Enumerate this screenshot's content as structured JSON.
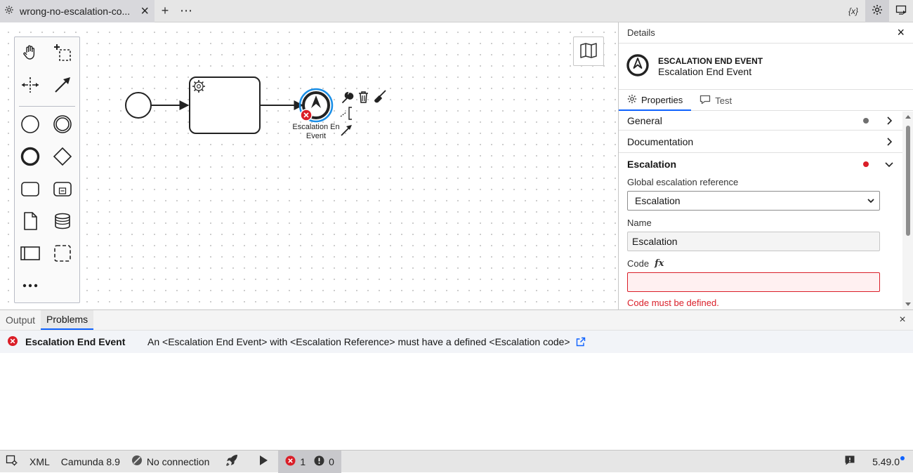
{
  "tab": {
    "title": "wrong-no-escalation-co...",
    "close_label": "×"
  },
  "tabbar": {
    "add_label": "+",
    "more_label": "⋯",
    "variables_label": "{x}"
  },
  "diagram": {
    "escalation_label_line1": "Escalation En",
    "escalation_label_line2": "Event"
  },
  "details": {
    "title": "Details",
    "close_label": "×",
    "element_type": "ESCALATION END EVENT",
    "element_name": "Escalation End Event",
    "tabs": [
      {
        "label": "Properties"
      },
      {
        "label": "Test"
      }
    ],
    "groups": {
      "general": "General",
      "documentation": "Documentation",
      "escalation": "Escalation"
    },
    "global_ref_label": "Global escalation reference",
    "global_ref_value": "Escalation",
    "name_label": "Name",
    "name_value": "Escalation",
    "code_label": "Code",
    "code_fx": "fx",
    "code_value": "",
    "code_error": "Code must be defined."
  },
  "bottom": {
    "tabs": [
      {
        "label": "Output"
      },
      {
        "label": "Problems"
      }
    ],
    "close_label": "×",
    "problems": [
      {
        "element": "Escalation End Event",
        "message": "An <Escalation End Event> with <Escalation Reference> must have a defined <Escalation code>"
      }
    ]
  },
  "status": {
    "xml": "XML",
    "engine": "Camunda 8.9",
    "connection": "No connection",
    "errors": "1",
    "warnings": "0",
    "version": "5.49.0"
  },
  "colors": {
    "accent": "#0f62fe",
    "error": "#da1e28",
    "selection": "#1a8ee6"
  }
}
